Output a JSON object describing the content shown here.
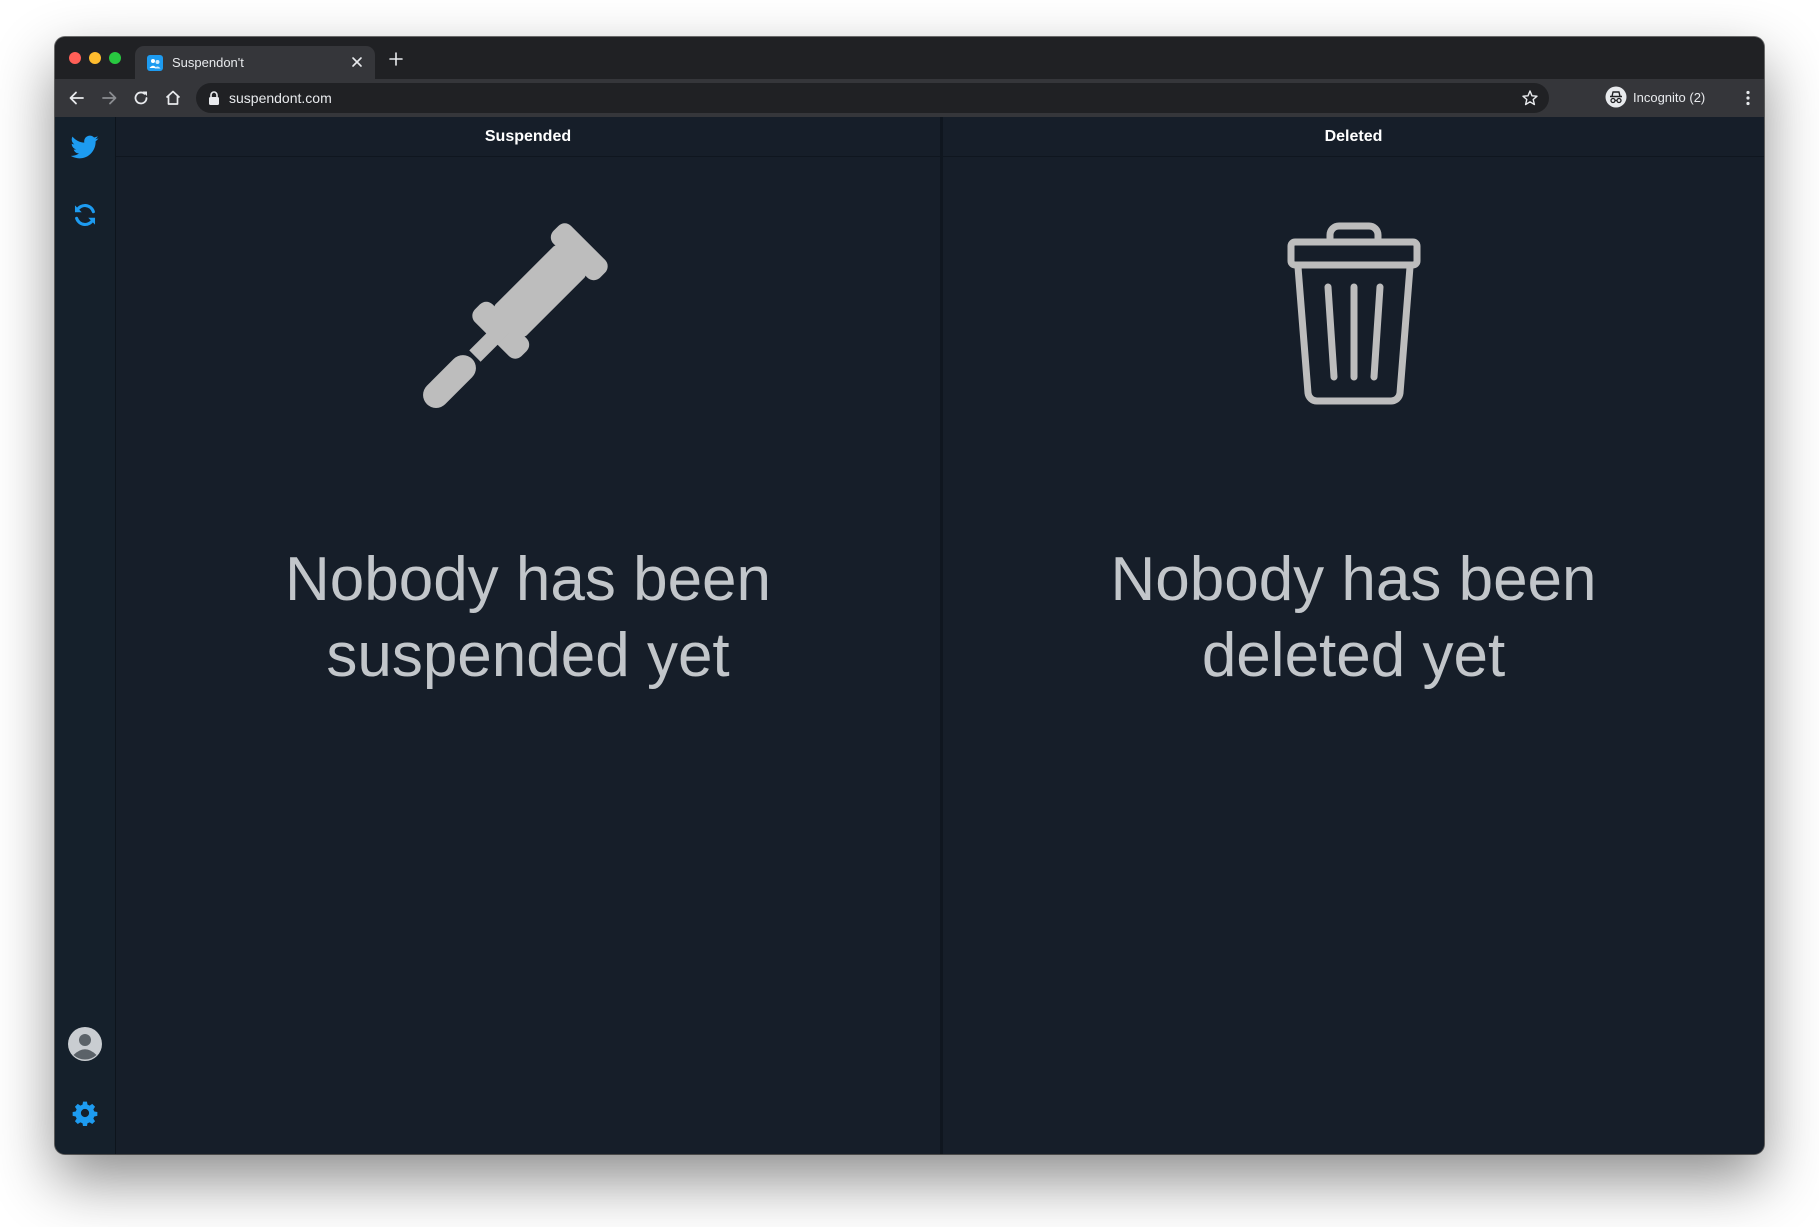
{
  "browser": {
    "tab_title": "Suspendon't",
    "url": "suspendont.com",
    "profile_label": "Incognito (2)",
    "icons": [
      "back-icon",
      "forward-icon",
      "reload-icon",
      "home-icon",
      "lock-icon",
      "star-icon",
      "incognito-icon",
      "kebab-menu-icon",
      "close-icon",
      "plus-icon"
    ]
  },
  "sidebar": {
    "items": [
      "twitter-icon",
      "refresh-icon",
      "avatar",
      "settings-gear-icon"
    ],
    "accent_color": "#1d9bf0"
  },
  "columns": [
    {
      "header": "Suspended",
      "icon": "gavel-icon",
      "empty_line1": "Nobody has been",
      "empty_line2": "suspended yet"
    },
    {
      "header": "Deleted",
      "icon": "trash-icon",
      "empty_line1": "Nobody has been",
      "empty_line2": "deleted yet"
    }
  ],
  "colors": {
    "background": "#161e29",
    "sidebar": "#15202b",
    "empty_text": "#c2c6ca",
    "icon_gray": "#bdbdbd"
  }
}
